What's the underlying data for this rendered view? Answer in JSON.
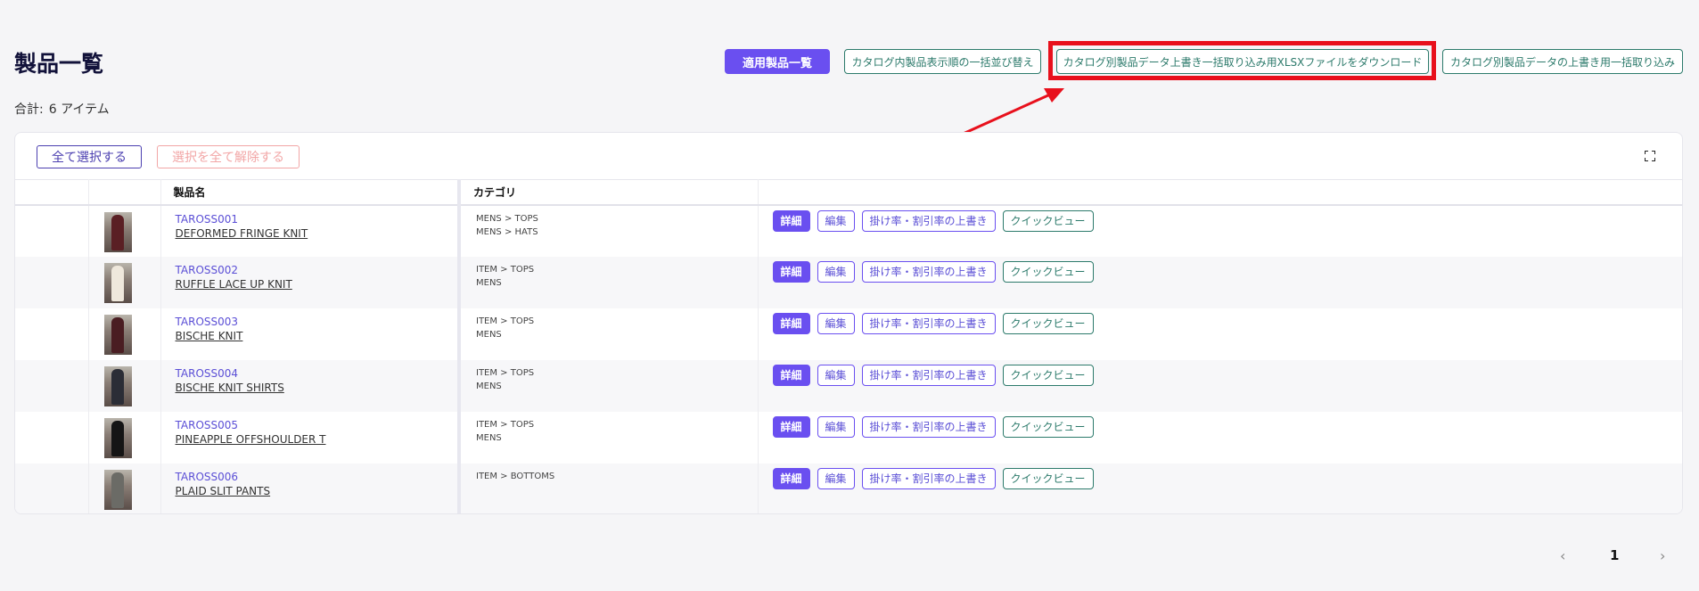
{
  "header": {
    "title": "製品一覧",
    "total_label": "合計:",
    "total_value": "6 アイテム",
    "buttons": {
      "applied_list": "適用製品一覧",
      "bulk_sort": "カタログ内製品表示順の一括並び替え",
      "download_xlsx": "カタログ別製品データ上書き一括取り込み用XLSXファイルをダウンロード",
      "bulk_import": "カタログ別製品データの上書き用一括取り込み"
    }
  },
  "toolbar": {
    "select_all": "全て選択する",
    "deselect_all": "選択を全て解除する"
  },
  "table": {
    "columns": [
      "",
      "",
      "製品名",
      "カテゴリ",
      ""
    ],
    "actions": {
      "detail": "詳細",
      "edit": "編集",
      "rate": "掛け率・割引率の上書き",
      "quick": "クイックビュー"
    },
    "rows": [
      {
        "code": "TAROSS001",
        "name": "DEFORMED FRINGE KNIT",
        "cat1": "MENS > TOPS",
        "cat2": "MENS > HATS"
      },
      {
        "code": "TAROSS002",
        "name": "RUFFLE LACE UP KNIT",
        "cat1": "ITEM > TOPS",
        "cat2": "MENS"
      },
      {
        "code": "TAROSS003",
        "name": "BISCHE KNIT",
        "cat1": "ITEM > TOPS",
        "cat2": "MENS"
      },
      {
        "code": "TAROSS004",
        "name": "BISCHE KNIT SHIRTS",
        "cat1": "ITEM > TOPS",
        "cat2": "MENS"
      },
      {
        "code": "TAROSS005",
        "name": "PINEAPPLE OFFSHOULDER T",
        "cat1": "ITEM > TOPS",
        "cat2": "MENS"
      },
      {
        "code": "TAROSS006",
        "name": "PLAID SLIT PANTS",
        "cat1": "ITEM > BOTTOMS",
        "cat2": ""
      }
    ]
  },
  "pagination": {
    "prev": "‹",
    "current": "1",
    "next": "›"
  },
  "colors": {
    "accent": "#6a4ff0",
    "teal": "#2c7a6b",
    "highlight": "#e8101c"
  }
}
